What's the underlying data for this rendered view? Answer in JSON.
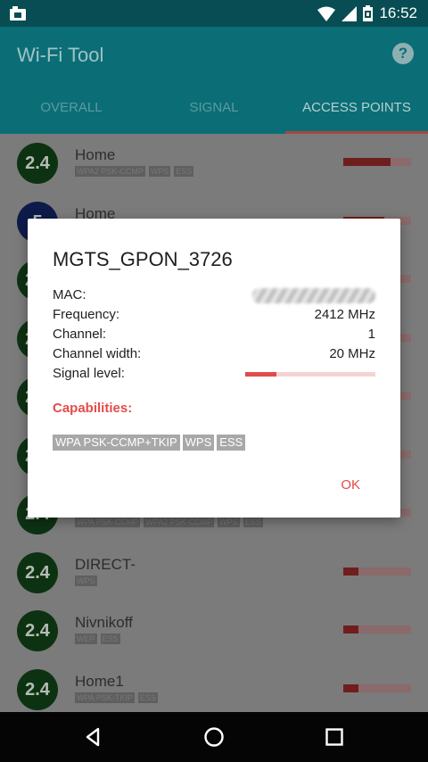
{
  "status_bar": {
    "time": "16:52",
    "icons": [
      "notification-icon",
      "wifi-icon",
      "cell-signal-icon",
      "battery-icon"
    ]
  },
  "app": {
    "title": "Wi-Fi Tool",
    "help_icon": "?"
  },
  "tabs": [
    {
      "label": "OVERALL",
      "active": false
    },
    {
      "label": "SIGNAL",
      "active": false
    },
    {
      "label": "ACCESS POINTS",
      "active": true
    }
  ],
  "list": [
    {
      "band": "2.4",
      "ssid": "Home",
      "badges": [
        "WPA2 PSK-CCMP",
        "WPS",
        "ESS"
      ],
      "signal": 0.7
    },
    {
      "band": "5",
      "ssid": "Home",
      "badges": [],
      "signal": 0.6
    },
    {
      "band": "2.4",
      "ssid": "",
      "badges": [],
      "signal": 0.2
    },
    {
      "band": "2.4",
      "ssid": "",
      "badges": [],
      "signal": 0.2
    },
    {
      "band": "2.4",
      "ssid": "",
      "badges": [],
      "signal": 0.2
    },
    {
      "band": "2.4",
      "ssid": "",
      "badges": [],
      "signal": 0.2
    },
    {
      "band": "2.4",
      "ssid": "",
      "badges": [
        "WPA PSK-CCMP",
        "WPA2 PSK-CCMP",
        "WPS",
        "ESS"
      ],
      "signal": 0.2
    },
    {
      "band": "2.4",
      "ssid": "DIRECT-",
      "badges": [
        "WPS"
      ],
      "signal": 0.22
    },
    {
      "band": "2.4",
      "ssid": "Nivnikoff",
      "badges": [
        "WEP",
        "ESS"
      ],
      "signal": 0.22
    },
    {
      "band": "2.4",
      "ssid": "Home1",
      "badges": [
        "WPA PSK-TKIP",
        "ESS"
      ],
      "signal": 0.22
    }
  ],
  "dialog": {
    "title": "MGTS_GPON_3726",
    "mac_label": "MAC:",
    "frequency_label": "Frequency:",
    "frequency_value": "2412 MHz",
    "channel_label": "Channel:",
    "channel_value": "1",
    "width_label": "Channel width:",
    "width_value": "20 MHz",
    "signal_label": "Signal level:",
    "signal_value": 0.24,
    "capabilities_label": "Capabilities:",
    "capabilities": [
      "WPA PSK-CCMP+TKIP",
      "WPS",
      "ESS"
    ],
    "ok_label": "OK"
  },
  "nav": [
    "back-icon",
    "home-icon",
    "recents-icon"
  ]
}
